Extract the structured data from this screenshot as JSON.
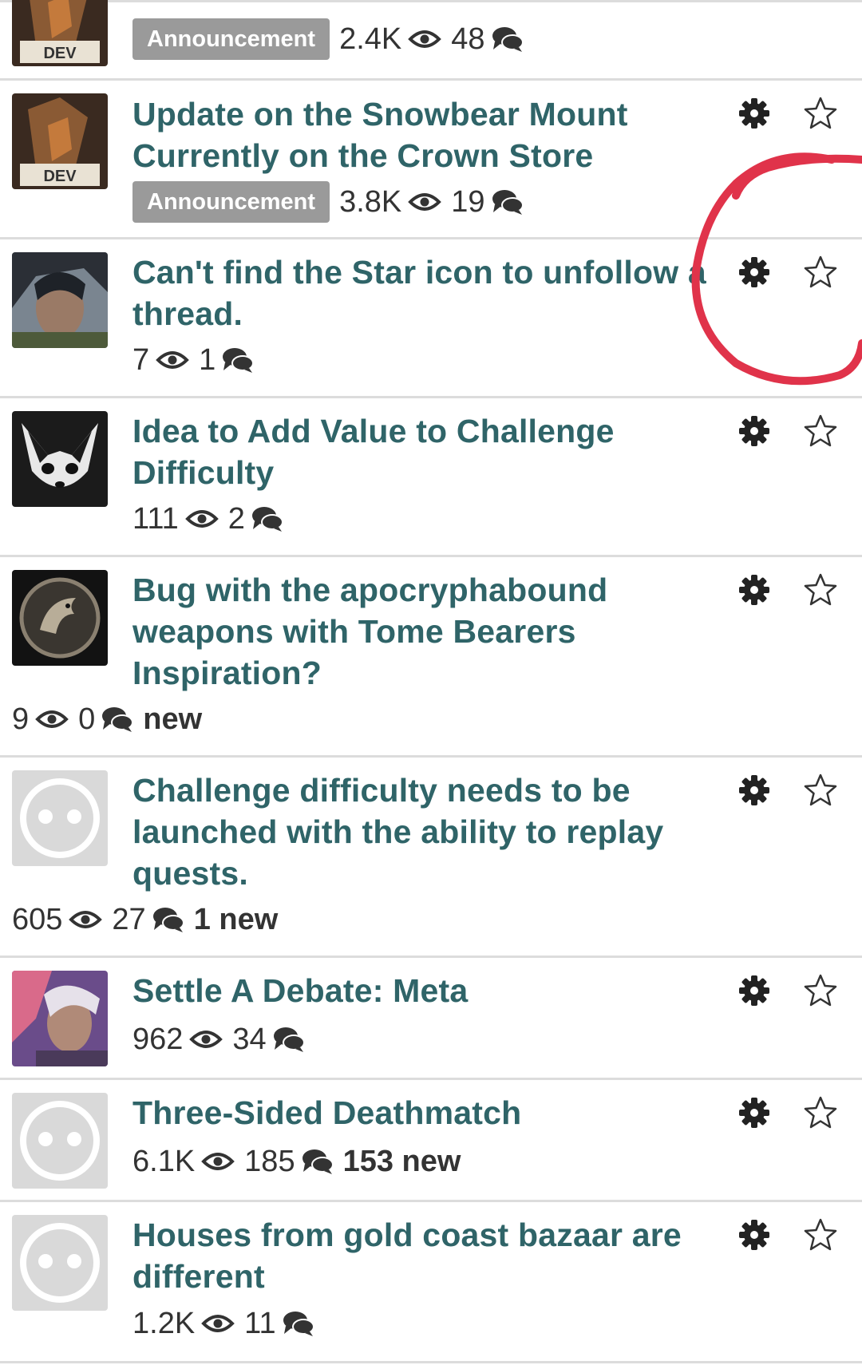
{
  "accent": "#2f6468",
  "threads": [
    {
      "title": "",
      "badge": "Announcement",
      "views": "2.4K",
      "comments": "48",
      "new_label": "",
      "avatar": "dev-avatar",
      "show_actions": false
    },
    {
      "title": "Update on the Snowbear Mount Currently on the Crown Store",
      "badge": "Announcement",
      "views": "3.8K",
      "comments": "19",
      "new_label": "",
      "avatar": "dev-avatar",
      "show_actions": true
    },
    {
      "title": "Can't find the Star icon to unfollow a thread.",
      "badge": "",
      "views": "7",
      "comments": "1",
      "new_label": "",
      "avatar": "elf-avatar",
      "show_actions": true
    },
    {
      "title": "Idea to Add Value to Challenge Difficulty",
      "badge": "",
      "views": "111",
      "comments": "2",
      "new_label": "",
      "avatar": "fox-avatar",
      "show_actions": true
    },
    {
      "title": "Bug with the apocryphabound weapons with Tome Bearers Inspiration?",
      "badge": "",
      "views": "9",
      "comments": "0",
      "new_label": "new",
      "avatar": "emblem-avatar",
      "show_actions": true
    },
    {
      "title": "Challenge difficulty needs to be launched with the ability to replay quests.",
      "badge": "",
      "views": "605",
      "comments": "27",
      "new_label": "1 new",
      "avatar": "default-avatar",
      "show_actions": true
    },
    {
      "title": "Settle A Debate: Meta",
      "badge": "",
      "views": "962",
      "comments": "34",
      "new_label": "",
      "avatar": "warrior-avatar",
      "show_actions": true
    },
    {
      "title": "Three-Sided Deathmatch",
      "badge": "",
      "views": "6.1K",
      "comments": "185",
      "new_label": "153 new",
      "avatar": "default-avatar",
      "show_actions": true
    },
    {
      "title": "Houses from gold coast bazaar are different",
      "badge": "",
      "views": "1.2K",
      "comments": "11",
      "new_label": "",
      "avatar": "default-avatar",
      "show_actions": true
    }
  ],
  "icons": {
    "views": "eye-icon",
    "comments": "chat-bubbles-icon",
    "settings": "gear-icon",
    "follow": "star-outline-icon"
  },
  "annotation": {
    "color": "#e0334a",
    "shape": "hand-drawn-circle"
  }
}
